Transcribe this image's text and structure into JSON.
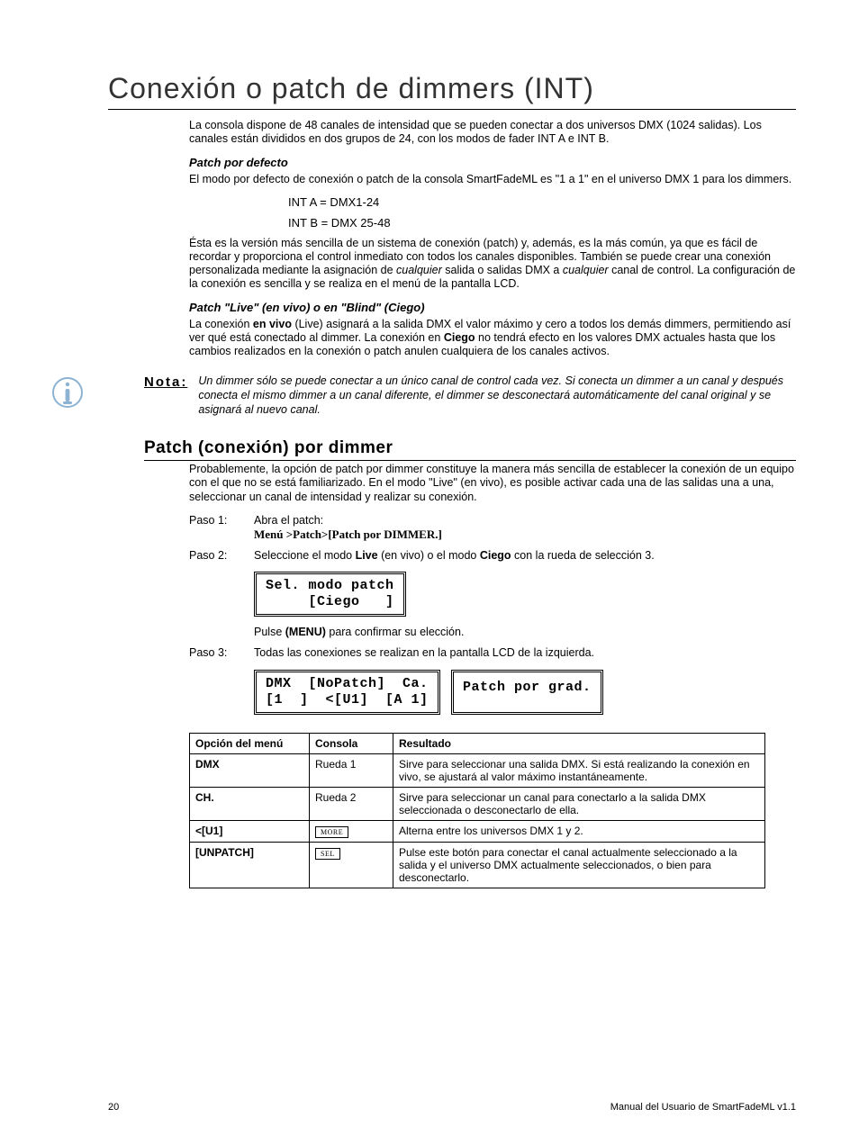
{
  "title": "Conexión o patch de dimmers (INT)",
  "intro": "La consola dispone de 48 canales de intensidad que se pueden conectar a dos universos DMX (1024 salidas). Los canales están divididos en dos grupos de 24, con los modos de fader INT A e INT B.",
  "sub1": "Patch por defecto",
  "p_default": "El modo por defecto de conexión o patch de la consola SmartFadeML es \"1 a 1\" en el universo DMX 1 para los dimmers.",
  "code_a": "INT A = DMX1-24",
  "code_b": "INT B = DMX 25-48",
  "p_explain_pre": "Ésta es la versión más sencilla de un sistema de conexión (patch) y, además, es la más común, ya que es fácil de recordar y proporciona el control inmediato con todos los canales disponibles. También se puede crear una conexión personalizada mediante la asignación de ",
  "p_explain_em1": "cualquier",
  "p_explain_mid": " salida o salidas DMX a ",
  "p_explain_em2": "cualquier",
  "p_explain_post": " canal de control. La configuración de la conexión es sencilla y se realiza en el menú de la pantalla LCD.",
  "sub2": "Patch \"Live\" (en vivo) o en \"Blind\" (Ciego)",
  "p_live_pre": "La conexión ",
  "p_live_b1": "en vivo",
  "p_live_mid": " (Live) asignará a la salida DMX el valor máximo y cero a todos los demás dimmers, permitiendo así ver qué está conectado al dimmer. La conexión en ",
  "p_live_b2": "Ciego",
  "p_live_post": " no tendrá efecto en los valores DMX actuales hasta que los cambios realizados en la conexión o patch anulen cualquiera de los canales activos.",
  "note_label": "Nota:",
  "note_body": "Un dimmer sólo se puede conectar a un único canal de control cada vez. Si conecta un dimmer a un canal y después conecta el mismo dimmer a un canal diferente, el dimmer se desconectará automáticamente del canal original y se asignará al nuevo canal.",
  "section2": "Patch (conexión) por dimmer",
  "p_section2": "Probablemente, la opción de patch por dimmer constituye la manera más sencilla de establecer la conexión de un equipo con el que no se está familiarizado. En el modo \"Live\" (en vivo), es posible activar cada una de las salidas una a una, seleccionar un canal de intensidad y realizar su conexión.",
  "steps": {
    "s1_label": "Paso 1:",
    "s1_body": "Abra el patch:",
    "s1_path": "Menú >Patch>[Patch por DIMMER.]",
    "s2_label": "Paso 2:",
    "s2_pre": "Seleccione el modo ",
    "s2_b1": "Live",
    "s2_mid": " (en vivo) o el modo ",
    "s2_b2": "Ciego",
    "s2_post": " con la rueda de selección 3.",
    "s3_label": "Paso 3:",
    "s3_body": "Todas las conexiones se realizan en la pantalla LCD de la izquierda."
  },
  "lcd1_l1": "Sel. modo patch",
  "lcd1_l2": "     [Ciego   ]",
  "after_lcd1_pre": "Pulse ",
  "after_lcd1_b": "(MENU)",
  "after_lcd1_post": " para confirmar su elección.",
  "lcd2_l1": "DMX  [NoPatch]  Ca.",
  "lcd2_l2": "[1  ]  <[U1]  [A 1]",
  "lcd3_l1": "Patch por grad.",
  "table": {
    "h1": "Opción del menú",
    "h2": "Consola",
    "h3": "Resultado",
    "rows": [
      {
        "c1": "DMX",
        "c2": "Rueda 1",
        "c3": "Sirve para seleccionar una salida DMX. Si está realizando la conexión en vivo, se ajustará al valor máximo instantáneamente."
      },
      {
        "c1": "CH.",
        "c2": "Rueda 2",
        "c3": "Sirve para seleccionar un canal para conectarlo a la salida DMX seleccionada o desconectarlo de ella."
      },
      {
        "c1": "<[U1]",
        "c2_btn": "MORE",
        "c3": "Alterna entre los universos DMX 1 y 2."
      },
      {
        "c1": "[UNPATCH]",
        "c2_btn": "SEL",
        "c3": "Pulse este botón para conectar el canal actualmente seleccionado a la salida y el universo DMX actualmente seleccionados, o bien para desconectarlo."
      }
    ]
  },
  "footer_page": "20",
  "footer_doc": "Manual del Usuario de SmartFadeML v1.1"
}
